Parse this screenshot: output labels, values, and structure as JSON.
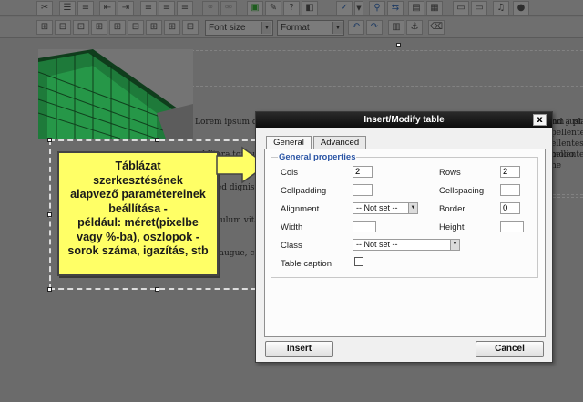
{
  "toolbar": {
    "font_size_label": "Font size",
    "format_label": "Format"
  },
  "content": {
    "lorem_lines": [
      "Lorem ipsum dolor sit amet, consectetur adipiscing elit. Praesent sapien libero, eleifend a plac",
      "ad litora torquent per conubia nostra, per inceptos himenaeos. Pellentesque pretium pellente",
      "est, sed digniss",
      "Vestibulum vitae",
      "dolor augue, con"
    ],
    "right_fragments": [
      "um just",
      "pellente",
      "ellentes",
      "modo ne"
    ]
  },
  "callout": {
    "lines": [
      "Táblázat",
      "szerkesztésének",
      "alapvező paramétereinek",
      "beállítása -",
      "például: méret(pixelbe",
      "vagy %-ba), oszlopok -",
      "sorok száma, igazítás, stb"
    ]
  },
  "dialog": {
    "title": "Insert/Modify table",
    "close_symbol": "x",
    "tabs": [
      "General",
      "Advanced"
    ],
    "legend": "General properties",
    "fields": {
      "cols_label": "Cols",
      "cols_value": "2",
      "rows_label": "Rows",
      "rows_value": "2",
      "cellpadding_label": "Cellpadding",
      "cellpadding_value": "",
      "cellspacing_label": "Cellspacing",
      "cellspacing_value": "",
      "alignment_label": "Alignment",
      "alignment_value": "-- Not set --",
      "border_label": "Border",
      "border_value": "0",
      "width_label": "Width",
      "width_value": "",
      "height_label": "Height",
      "height_value": "",
      "class_label": "Class",
      "class_value": "-- Not set --",
      "caption_label": "Table caption"
    },
    "insert_label": "Insert",
    "cancel_label": "Cancel"
  },
  "colors": {
    "callout_fill": "#ffff66",
    "legend_text": "#2b55a5",
    "titlebar": "#111111"
  }
}
